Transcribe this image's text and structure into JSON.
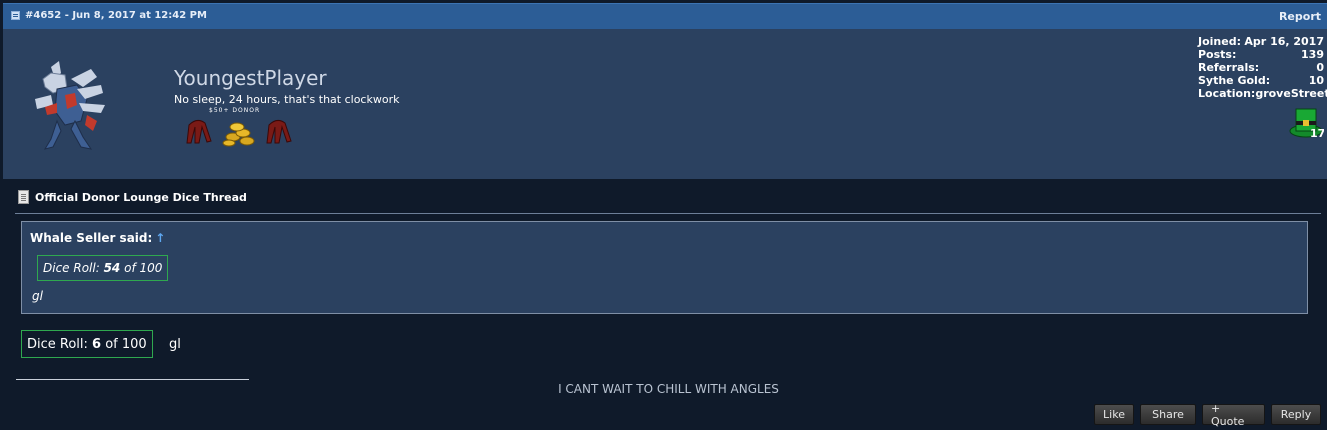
{
  "post": {
    "meta": "#4652 - Jun 8, 2017 at 12:42 PM",
    "report_label": "Report"
  },
  "user": {
    "name": "YoungestPlayer",
    "title": "No sleep, 24 hours, that's that clockwork",
    "donor_label": "$50+  DONOR",
    "stats": [
      {
        "label": "Joined:",
        "value": "Apr 16, 2017"
      },
      {
        "label": "Posts:",
        "value": "139"
      },
      {
        "label": "Referrals:",
        "value": "0"
      },
      {
        "label": "Sythe Gold:",
        "value": "10"
      },
      {
        "label": "Location:",
        "value": "groveStreet"
      }
    ],
    "badge_count": "17"
  },
  "thread": {
    "title": "Official Donor Lounge Dice Thread"
  },
  "quote": {
    "author": "Whale Seller said:",
    "arrow": "↑",
    "dice_prefix": "Dice Roll: ",
    "dice_value": "54",
    "dice_suffix": " of 100",
    "text": "gl"
  },
  "body": {
    "dice_prefix": "Dice Roll: ",
    "dice_value": "6",
    "dice_suffix": " of 100",
    "text": "gl",
    "signature": "I CANT WAIT TO CHILL WITH ANGLES"
  },
  "actions": {
    "like": "Like",
    "share": "Share",
    "quote": "+ Quote",
    "reply": "Reply"
  },
  "colors": {
    "header_blue": "#2c5d96",
    "panel": "#2b4160",
    "background": "#0f1a2a",
    "dice_border": "#2fa84f",
    "link_arrow": "#5ea7f0"
  }
}
